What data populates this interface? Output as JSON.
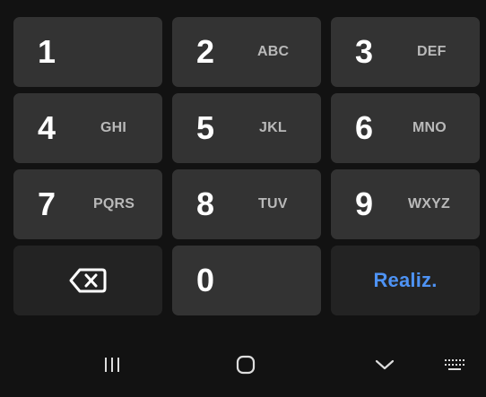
{
  "keypad": {
    "keys": [
      {
        "digit": "1",
        "letters": ""
      },
      {
        "digit": "2",
        "letters": "ABC"
      },
      {
        "digit": "3",
        "letters": "DEF"
      },
      {
        "digit": "4",
        "letters": "GHI"
      },
      {
        "digit": "5",
        "letters": "JKL"
      },
      {
        "digit": "6",
        "letters": "MNO"
      },
      {
        "digit": "7",
        "letters": "PQRS"
      },
      {
        "digit": "8",
        "letters": "TUV"
      },
      {
        "digit": "9",
        "letters": "WXYZ"
      },
      {
        "digit": "0",
        "letters": ""
      }
    ],
    "backspace_icon": "backspace-icon",
    "done_label": "Realiz."
  },
  "nav": {
    "recents_icon": "recents-icon",
    "home_icon": "home-icon",
    "back_icon": "chevron-down-icon",
    "keyboard_icon": "keyboard-icon"
  },
  "colors": {
    "background": "#121212",
    "key": "#333333",
    "special_key": "#232323",
    "accent": "#4e93f5",
    "letters": "#b9b9b9"
  }
}
